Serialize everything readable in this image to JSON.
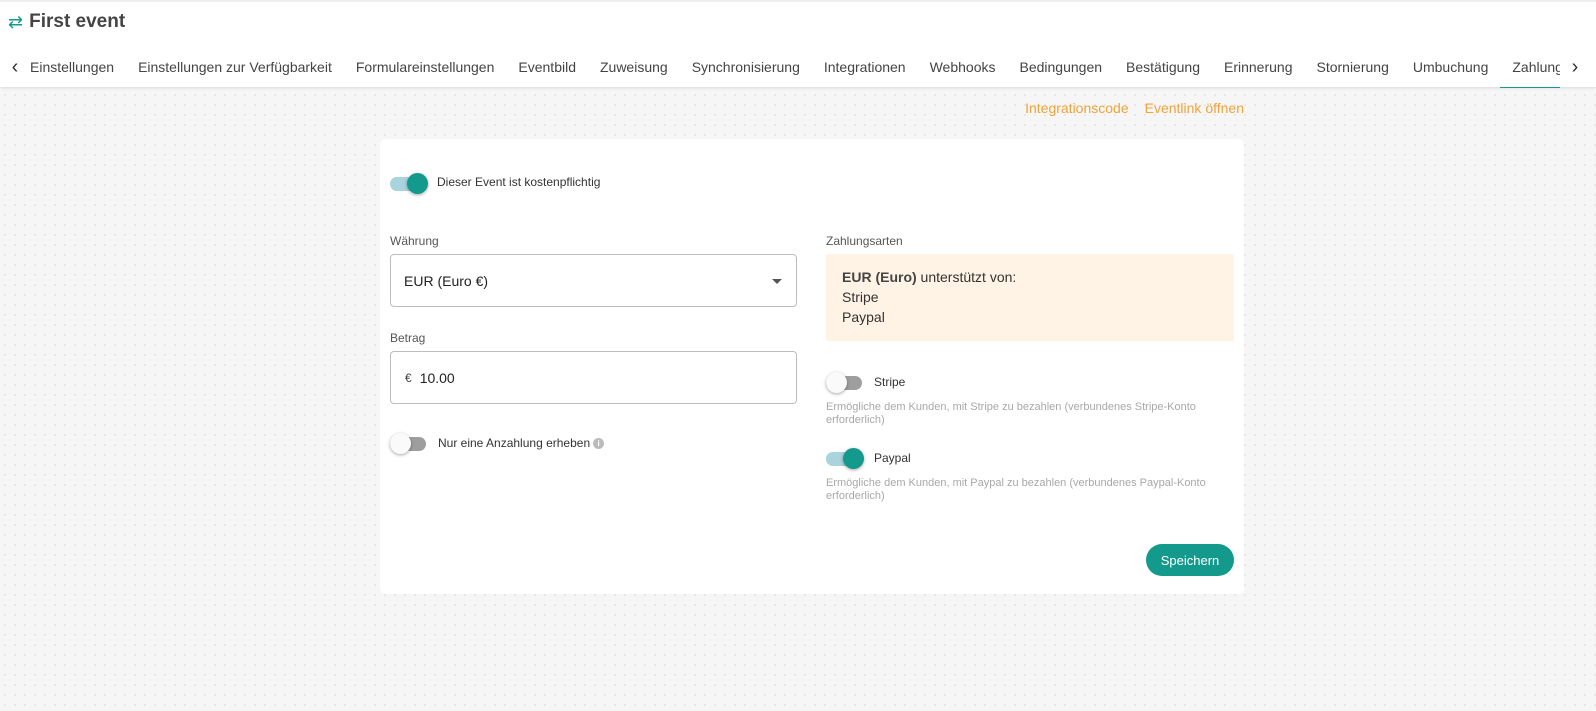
{
  "header": {
    "swap_icon": "swap-arrows-icon",
    "title": "First event"
  },
  "tabs": [
    {
      "label": "Einstellungen"
    },
    {
      "label": "Einstellungen zur Verfügbarkeit"
    },
    {
      "label": "Formulareinstellungen"
    },
    {
      "label": "Eventbild"
    },
    {
      "label": "Zuweisung"
    },
    {
      "label": "Synchronisierung"
    },
    {
      "label": "Integrationen"
    },
    {
      "label": "Webhooks"
    },
    {
      "label": "Bedingungen"
    },
    {
      "label": "Bestätigung"
    },
    {
      "label": "Erinnerung"
    },
    {
      "label": "Stornierung"
    },
    {
      "label": "Umbuchung"
    },
    {
      "label": "Zahlung",
      "active": true
    }
  ],
  "nav": {
    "prev_glyph": "‹",
    "next_glyph": "›"
  },
  "links": {
    "integration_code": "Integrationscode",
    "open_event_link": "Eventlink öffnen"
  },
  "payment": {
    "paid_toggle": {
      "label": "Dieser Event ist kostenpflichtig",
      "on": true
    },
    "currency": {
      "label": "Währung",
      "value": "EUR (Euro €)"
    },
    "amount": {
      "label": "Betrag",
      "prefix": "€",
      "value": "10.00"
    },
    "deposit_toggle": {
      "label": "Nur eine Anzahlung erheben",
      "on": false,
      "info_glyph": "i"
    },
    "methods_label": "Zahlungsarten",
    "support_notice": {
      "currency_bold": "EUR (Euro)",
      "suffix": " unterstützt von:",
      "providers": [
        "Stripe",
        "Paypal"
      ]
    },
    "stripe": {
      "label": "Stripe",
      "on": false,
      "hint": "Ermögliche dem Kunden, mit Stripe zu bezahlen (verbundenes Stripe-Konto erforderlich)"
    },
    "paypal": {
      "label": "Paypal",
      "on": true,
      "hint": "Ermögliche dem Kunden, mit Paypal zu bezahlen (verbundenes Paypal-Konto erforderlich)"
    },
    "save_label": "Speichern"
  },
  "colors": {
    "accent": "#139a8c",
    "link": "#f0a33a",
    "notice_bg": "#fff3e5"
  }
}
